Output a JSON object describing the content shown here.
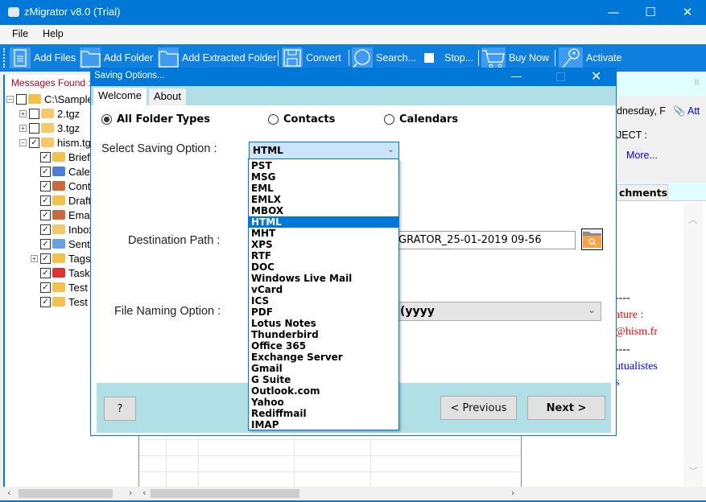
{
  "window": {
    "title": "zMigrator v8.0 (Trial)",
    "controls": {
      "minimize": "—",
      "maximize": "☐",
      "close": "✕"
    }
  },
  "menu": [
    "File",
    "Help"
  ],
  "toolbar": [
    {
      "label": "Add Files",
      "icon": "file-icon"
    },
    {
      "label": "Add Folder",
      "icon": "folder-icon"
    },
    {
      "label": "Add Extracted Folder",
      "icon": "folder-icon"
    },
    {
      "label": "Convert",
      "icon": "save-icon"
    },
    {
      "label": "Search...",
      "icon": "search-icon"
    },
    {
      "label": "Stop...",
      "icon": "stop-icon"
    },
    {
      "label": "Buy Now",
      "icon": "cart-icon"
    },
    {
      "label": "Activate",
      "icon": "key-icon"
    }
  ],
  "left_pane": {
    "header": "Messages Found :",
    "tree": [
      {
        "label": "C:\\Sample",
        "checked": false,
        "expander": "−",
        "icon": "drive-folder-icon"
      },
      {
        "label": "2.tgz",
        "checked": false,
        "expander": "+",
        "icon": "mail-icon"
      },
      {
        "label": "3.tgz",
        "checked": false,
        "expander": "+",
        "icon": "mail-icon"
      },
      {
        "label": "hism.tgz",
        "checked": true,
        "expander": "−",
        "icon": "mail-icon"
      },
      {
        "label": "Brief",
        "checked": true,
        "icon": "folder-icon"
      },
      {
        "label": "Cale",
        "checked": true,
        "icon": "calendar-icon"
      },
      {
        "label": "Cont",
        "checked": true,
        "icon": "contact-card-icon"
      },
      {
        "label": "Draft",
        "checked": true,
        "icon": "drafts-icon"
      },
      {
        "label": "Ema",
        "checked": true,
        "icon": "contact-card-icon"
      },
      {
        "label": "Inbox",
        "checked": true,
        "icon": "inbox-icon"
      },
      {
        "label": "Sent",
        "checked": true,
        "icon": "sent-icon"
      },
      {
        "label": "Tags",
        "checked": true,
        "expander": "+",
        "icon": "folder-icon"
      },
      {
        "label": "Task",
        "checked": true,
        "icon": "tasks-icon"
      },
      {
        "label": "Test",
        "checked": true,
        "icon": "folder-icon"
      },
      {
        "label": "Test",
        "checked": true,
        "icon": "folder-icon"
      }
    ]
  },
  "right_pane": {
    "date_fragment": "dnesday, F",
    "attachment_link": "Att",
    "subject_label": "JECT :",
    "more_link": "More...",
    "tab_attachments": "chments",
    "body_lines": [
      {
        "text": "----",
        "color": "#000000"
      },
      {
        "text": "ature :",
        "color": "#ff0000"
      },
      {
        "text": "@hism.fr",
        "color": "#ff0000"
      },
      {
        "text": "----",
        "color": "#000000"
      },
      {
        "text": "utualistes",
        "color": "#0000ff"
      },
      {
        "text": "s",
        "color": "#0000ff"
      }
    ]
  },
  "dialog": {
    "title": "Saving Options...",
    "tabs": [
      "Welcome",
      "About"
    ],
    "active_tab": "Welcome",
    "radios": [
      {
        "label": "All Folder Types",
        "selected": true
      },
      {
        "label": "Contacts",
        "selected": false
      },
      {
        "label": "Calendars",
        "selected": false
      }
    ],
    "saving_option_label": "Select Saving Option :",
    "saving_option_value": "HTML",
    "saving_options": [
      "PST",
      "MSG",
      "EML",
      "EMLX",
      "MBOX",
      "HTML",
      "MHT",
      "XPS",
      "RTF",
      "DOC",
      "Windows Live Mail",
      "vCard",
      "ICS",
      "PDF",
      "Lotus Notes",
      "Thunderbird",
      "Office 365",
      "Exchange Server",
      "Gmail",
      "G Suite",
      "Outlook.com",
      "Yahoo",
      "Rediffmail",
      "IMAP"
    ],
    "destination_label": "Destination Path :",
    "destination_value": "GRATOR_25-01-2019 09-56",
    "naming_label": "File Naming Option :",
    "naming_value": "yyyy)",
    "help_button": "?",
    "previous_button": "< Previous",
    "next_button": "Next >"
  }
}
